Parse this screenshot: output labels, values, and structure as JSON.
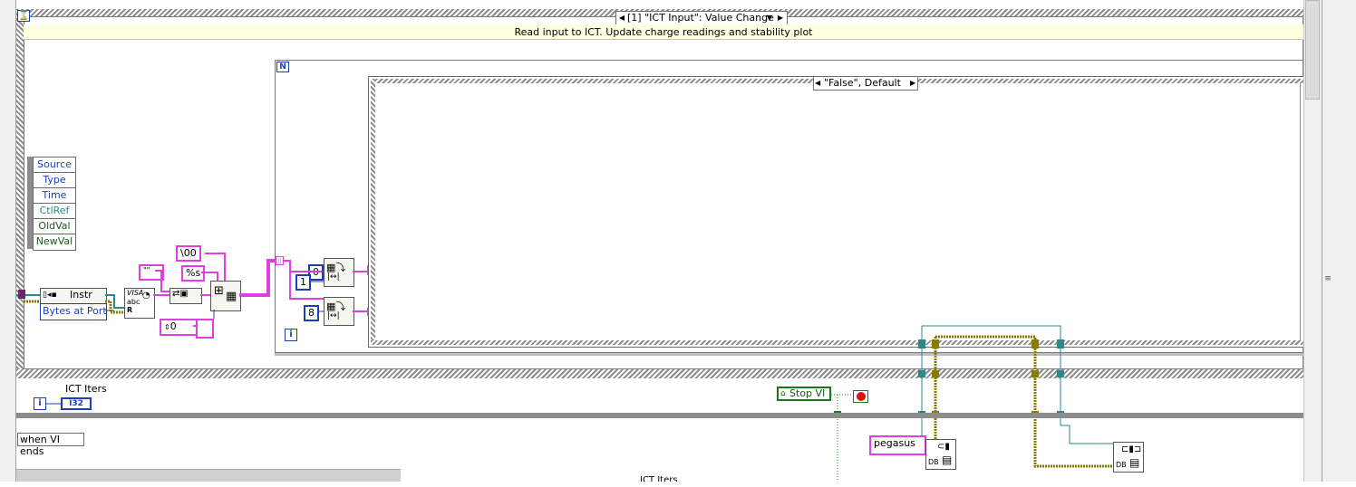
{
  "event_structure": {
    "case_selector": "[1] \"ICT Input\": Value Change",
    "subdiagram_label": "Read input to ICT. Update charge readings and stability plot",
    "event_data_node": [
      "Source",
      "Type",
      "Time",
      "CtlRef",
      "OldVal",
      "NewVal"
    ]
  },
  "visa_nodes": {
    "instr_label": "Instr",
    "bytes_at_port_label": "Bytes at Port",
    "visa_read_label": "VISA"
  },
  "constants": {
    "null_string": "\\00",
    "format_string": "%s",
    "empty_string": "\"\"",
    "zero_index": "0",
    "zero": "0",
    "one": "1",
    "eight": "8"
  },
  "for_loop": {
    "count_terminal": "N",
    "iteration_terminal": "i"
  },
  "inner_case": {
    "selector": "\"False\", Default"
  },
  "ict_iters": {
    "label": "ICT Iters",
    "indicator_type": "I32",
    "iteration_terminal": "i"
  },
  "stop_vi": {
    "label": "Stop VI"
  },
  "while_loop": {
    "when_vi_ends": "when VI ends"
  },
  "db": {
    "pegasus": "pegasus",
    "db_label": "DB"
  },
  "bottom_partial_label": "ICT Iters",
  "colors": {
    "string_wire": "#e03ee0",
    "numeric_wire": "#1c3fb4",
    "refnum_wire": "#2a8a8a",
    "cluster_wire": "#8a7a00",
    "boolean_wire": "#1a7a1a",
    "label_background": "#ffffe1"
  }
}
